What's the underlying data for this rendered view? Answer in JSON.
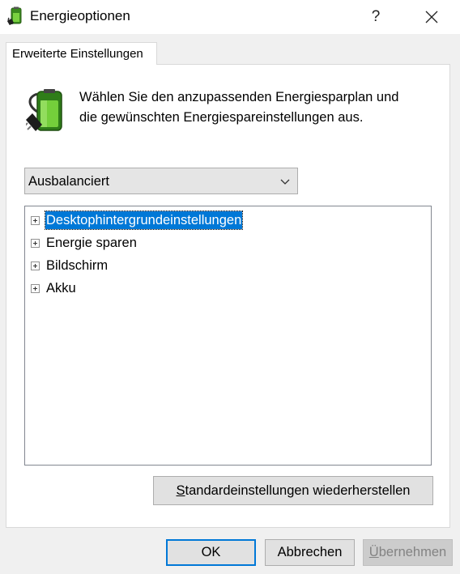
{
  "window": {
    "title": "Energieoptionen",
    "icon": "battery-plug-icon",
    "help_label": "?",
    "close_icon": "close-icon"
  },
  "tabs": [
    {
      "label": "Erweiterte Einstellungen",
      "active": true
    }
  ],
  "header": {
    "icon": "power-plan-battery-icon",
    "line1": "Wählen Sie den anzupassenden Energiesparplan und",
    "line2": "die gewünschten Energiespareinstellungen aus."
  },
  "plan_select": {
    "selected": "Ausbalanciert",
    "icon": "chevron-down-icon"
  },
  "tree": {
    "items": [
      {
        "label": "Desktophintergrundeinstellungen",
        "selected": true
      },
      {
        "label": "Energie sparen",
        "selected": false
      },
      {
        "label": "Bildschirm",
        "selected": false
      },
      {
        "label": "Akku",
        "selected": false
      }
    ]
  },
  "buttons": {
    "restore": {
      "accel": "S",
      "rest": "tandardeinstellungen wiederherstellen"
    },
    "ok": "OK",
    "cancel": "Abbrechen",
    "apply": {
      "accel": "Ü",
      "rest": "bernehmen",
      "disabled": true
    }
  },
  "colors": {
    "selection": "#0078d7",
    "dialog_bg": "#f0f0f0",
    "panel_bg": "#ffffff",
    "battery_green": "#5fbf2a"
  }
}
